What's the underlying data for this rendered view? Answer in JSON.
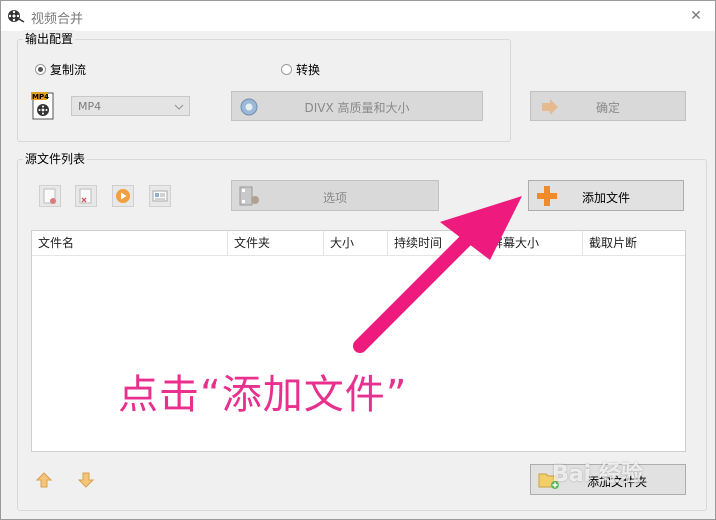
{
  "window": {
    "title": "视频合并"
  },
  "output_config": {
    "legend": "输出配置",
    "radio_copy": "复制流",
    "radio_convert": "转换",
    "selected_radio": "copy",
    "format_value": "MP4",
    "preset_label": "DIVX 高质量和大小",
    "confirm_label": "确定"
  },
  "source_list": {
    "legend": "源文件列表",
    "options_label": "选项",
    "add_file_label": "添加文件",
    "add_folder_label": "添加文件夹",
    "columns": [
      "文件名",
      "文件夹",
      "大小",
      "持续时间",
      "屏幕大小",
      "截取片断"
    ]
  },
  "annotation": {
    "text": "点击“添加文件”",
    "color": "#e8308f"
  },
  "watermark": {
    "text": "Bai 经验"
  }
}
